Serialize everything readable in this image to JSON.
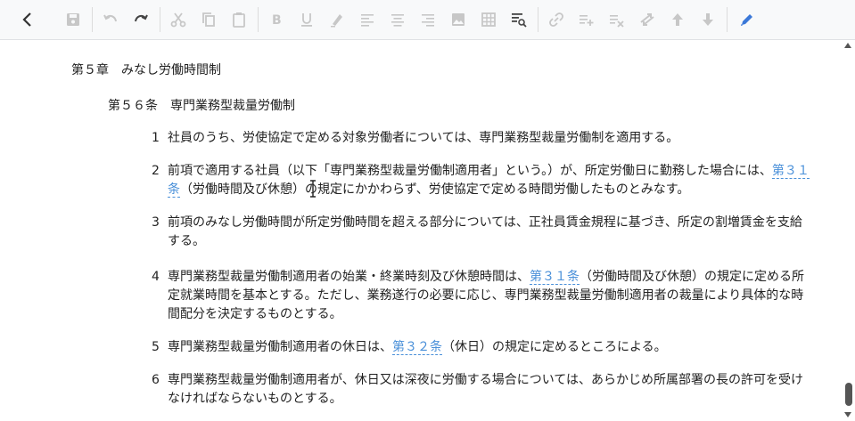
{
  "toolbar": {
    "icons": [
      "back-icon",
      "save-icon",
      "undo-icon",
      "redo-icon",
      "cut-icon",
      "copy-icon",
      "paste-icon",
      "bold-icon",
      "underline-icon",
      "highlight-icon",
      "align-left-icon",
      "align-center-icon",
      "align-right-icon",
      "image-icon",
      "table-icon",
      "find-icon",
      "link-icon",
      "add-item-icon",
      "clear-format-icon",
      "swap-icon",
      "move-up-icon",
      "move-down-icon",
      "edit-icon"
    ],
    "accent_color": "#3b78d8"
  },
  "document": {
    "chapter": "第５章　みなし労働時間制",
    "article": "第５６条　専門業務型裁量労働制",
    "clauses": [
      {
        "num": "1",
        "text": "社員のうち、労使協定で定める対象労働者については、専門業務型裁量労働制を適用する。"
      },
      {
        "num": "2",
        "pre": "前項で適用する社員（以下「専門業務型裁量労働制適用者」という。）が、所定労働日に勤務した場合には、",
        "link": "第３１条",
        "post": "（労働時間及び休憩）の規定にかかわらず、労使協定で定める時間労働したものとみなす。"
      },
      {
        "num": "3",
        "text": "前項のみなし労働時間が所定労働時間を超える部分については、正社員賃金規程に基づき、所定の割増賃金を支給する。"
      },
      {
        "num": "4",
        "pre": "専門業務型裁量労働制適用者の始業・終業時刻及び休憩時間は、",
        "link": "第３１条",
        "post": "（労働時間及び休憩）の規定に定める所定就業時間を基本とする。ただし、業務遂行の必要に応じ、専門業務型裁量労働制適用者の裁量により具体的な時間配分を決定するものとする。"
      },
      {
        "num": "5",
        "pre": "専門業務型裁量労働制適用者の休日は、",
        "link": "第３２条",
        "post": "（休日）の規定に定めるところによる。"
      },
      {
        "num": "6",
        "text": "専門業務型裁量労働制適用者が、休日又は深夜に労働する場合については、あらかじめ所属部署の長の許可を受けなければならないものとする。"
      }
    ]
  }
}
